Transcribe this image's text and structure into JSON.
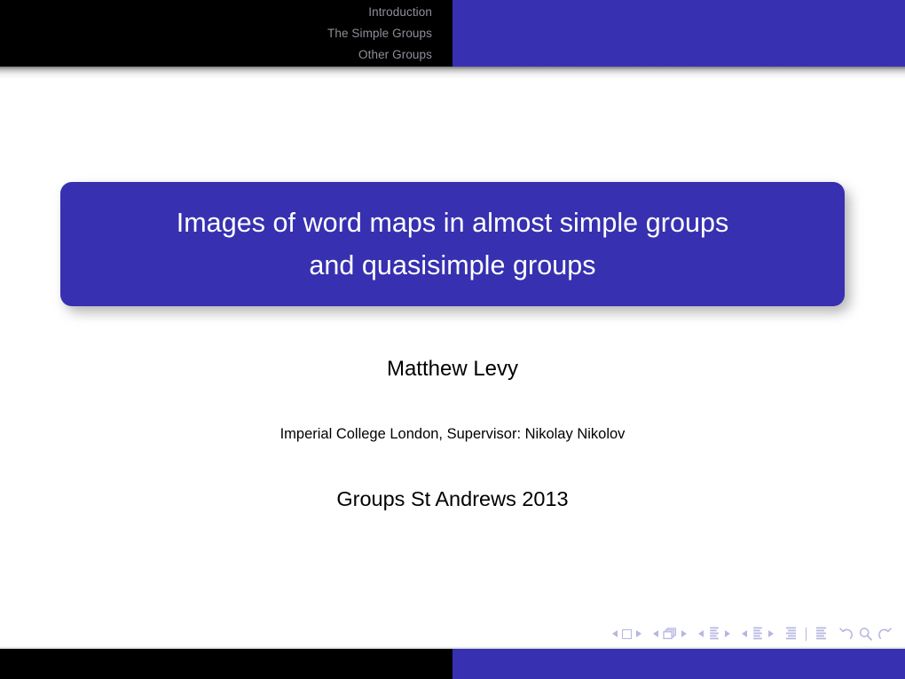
{
  "header": {
    "nav_items": [
      {
        "label": "Introduction"
      },
      {
        "label": "The Simple Groups"
      },
      {
        "label": "Other Groups"
      }
    ],
    "left_bg_color": "#000000",
    "right_bg_color": "#3730b0",
    "nav_text_color": "#8f8f98"
  },
  "title": {
    "line1": "Images of word maps in almost simple groups",
    "line2": "and quasisimple groups",
    "box_color": "#3730b0",
    "text_color": "#ffffff"
  },
  "author": {
    "name": "Matthew Levy"
  },
  "institute": {
    "text": "Imperial College London, Supervisor: Nikolay Nikolov"
  },
  "date": {
    "text": "Groups St Andrews 2013"
  },
  "nav_symbols": {
    "color": "#b6b6e2",
    "groups": [
      {
        "name": "slide-navigation",
        "prev_icon": "triangle-left-icon",
        "target_icon": "slide-square-icon",
        "next_icon": "triangle-right-icon"
      },
      {
        "name": "frame-navigation",
        "prev_icon": "triangle-left-icon",
        "target_icon": "frames-stack-icon",
        "next_icon": "triangle-right-icon"
      },
      {
        "name": "subsection-navigation",
        "prev_icon": "triangle-left-icon",
        "target_icon": "subsection-lines-icon",
        "next_icon": "triangle-right-icon"
      },
      {
        "name": "section-navigation",
        "prev_icon": "triangle-left-icon",
        "target_icon": "section-lines-icon",
        "next_icon": "triangle-right-icon"
      },
      {
        "name": "document-navigation",
        "begin_icon": "document-begin-icon",
        "end_icon": "document-end-icon"
      },
      {
        "name": "history-navigation",
        "back_icon": "back-arrow-icon",
        "search_icon": "search-magnifier-icon",
        "forward_icon": "forward-arrow-icon"
      }
    ]
  },
  "footer": {
    "left_bg_color": "#000000",
    "right_bg_color": "#3730b0"
  }
}
